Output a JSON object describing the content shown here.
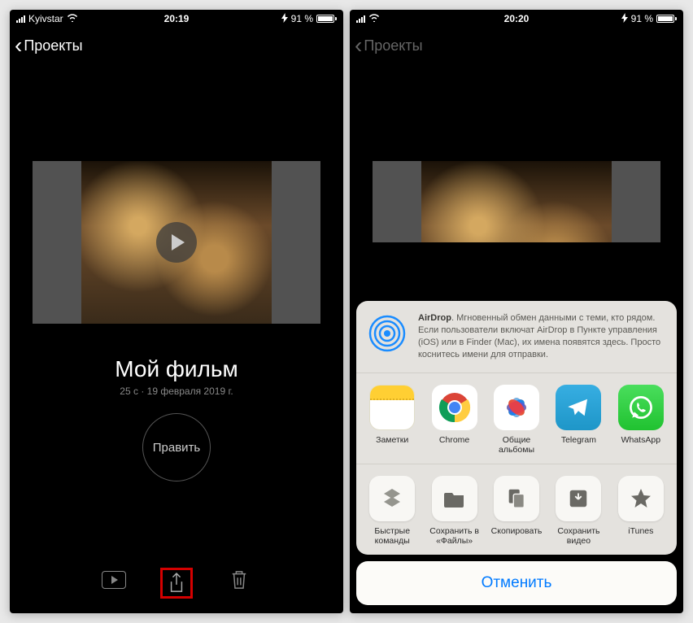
{
  "left": {
    "status": {
      "carrier": "Kyivstar",
      "time": "20:19",
      "battery_pct": "91 %"
    },
    "nav": {
      "back": "Проекты"
    },
    "movie": {
      "title": "Мой фильм",
      "meta": "25 с · 19 февраля 2019 г."
    },
    "edit_label": "Править"
  },
  "right": {
    "status": {
      "time": "20:20",
      "battery_pct": "91 %"
    },
    "nav": {
      "back": "Проекты"
    },
    "airdrop": {
      "title": "AirDrop",
      "desc": ". Мгновенный обмен данными с теми, кто рядом. Если пользователи включат AirDrop в Пункте управления (iOS) или в Finder (Mac), их имена появятся здесь. Просто коснитесь имени для отправки."
    },
    "apps": [
      {
        "label": "Заметки"
      },
      {
        "label": "Chrome"
      },
      {
        "label": "Общие альбомы"
      },
      {
        "label": "Telegram"
      },
      {
        "label": "WhatsApp"
      }
    ],
    "actions": [
      {
        "label": "Быстрые команды"
      },
      {
        "label": "Сохранить в «Файлы»"
      },
      {
        "label": "Скопировать"
      },
      {
        "label": "Сохранить видео"
      },
      {
        "label": "iTunes"
      }
    ],
    "cancel": "Отменить"
  }
}
